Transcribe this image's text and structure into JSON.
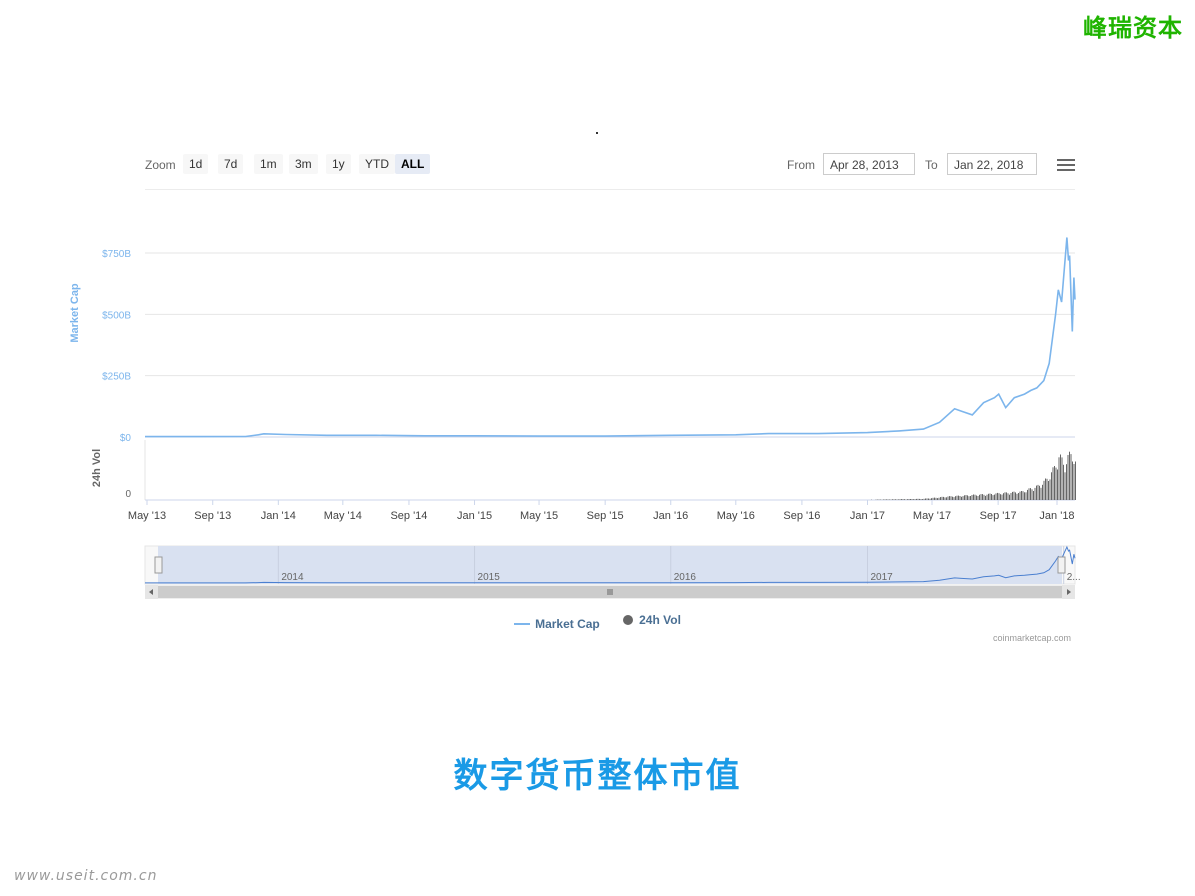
{
  "brand": "峰瑞资本",
  "slide_title": "数字货币整体市值",
  "watermark": "www.useit.com.cn",
  "toolbar": {
    "zoom_label": "Zoom",
    "zoom_buttons": [
      "1d",
      "7d",
      "1m",
      "3m",
      "1y",
      "YTD",
      "ALL"
    ],
    "active_zoom": "ALL",
    "from_label": "From",
    "from_value": "Apr 28, 2013",
    "to_label": "To",
    "to_value": "Jan 22, 2018",
    "menu_icon": "hamburger-menu-icon"
  },
  "legend": {
    "market_cap": "Market Cap",
    "vol": "24h Vol"
  },
  "credits": "coinmarketcap.com",
  "colors": {
    "market_cap": "#7cb5ec",
    "volume": "#666666",
    "navigator_fill": "#d9e1f1",
    "brand": "#1fb400",
    "title": "#1a9ae6"
  },
  "chart_data": {
    "type": "line",
    "xlabel": "",
    "ylabel": "Market Cap",
    "ylabel2": "24h Vol",
    "yticks": [
      "$750B",
      "$500B",
      "$250B",
      "$0"
    ],
    "yticks2": [
      "0"
    ],
    "ylim": [
      0,
      750
    ],
    "y_unit": "B USD",
    "xticks": [
      "May '13",
      "Sep '13",
      "Jan '14",
      "May '14",
      "Sep '14",
      "Jan '15",
      "May '15",
      "Sep '15",
      "Jan '16",
      "May '16",
      "Sep '16",
      "Jan '17",
      "May '17",
      "Sep '17",
      "Jan '18"
    ],
    "navigator_ticks": [
      "2014",
      "2015",
      "2016",
      "2017",
      "2..."
    ],
    "grid": true,
    "legend_position": "bottom",
    "series": [
      {
        "name": "Market Cap",
        "x": [
          "2013-04-28",
          "2013-08-01",
          "2013-11-01",
          "2013-11-25",
          "2013-12-05",
          "2014-01-15",
          "2014-04-01",
          "2014-07-01",
          "2014-10-01",
          "2015-01-01",
          "2015-05-01",
          "2015-09-01",
          "2016-01-01",
          "2016-05-01",
          "2016-07-01",
          "2016-10-01",
          "2017-01-01",
          "2017-03-01",
          "2017-04-15",
          "2017-05-15",
          "2017-06-12",
          "2017-06-25",
          "2017-07-15",
          "2017-08-05",
          "2017-08-25",
          "2017-09-02",
          "2017-09-15",
          "2017-10-01",
          "2017-10-20",
          "2017-11-01",
          "2017-11-12",
          "2017-11-25",
          "2017-12-05",
          "2017-12-17",
          "2017-12-22",
          "2017-12-28",
          "2018-01-07",
          "2018-01-10",
          "2018-01-12",
          "2018-01-17",
          "2018-01-18",
          "2018-01-20",
          "2018-01-22"
        ],
        "values": [
          1.5,
          1.5,
          2,
          9,
          13,
          10,
          7,
          7,
          5,
          5,
          3.5,
          3.5,
          7,
          9,
          14,
          14,
          18,
          25,
          32,
          60,
          115,
          105,
          90,
          140,
          160,
          175,
          120,
          160,
          175,
          190,
          200,
          230,
          300,
          500,
          600,
          550,
          813,
          720,
          740,
          430,
          500,
          650,
          560
        ]
      },
      {
        "name": "24h Vol",
        "x": [
          "2013-04-28",
          "2013-12-01",
          "2014-06-01",
          "2015-06-01",
          "2016-06-01",
          "2017-01-01",
          "2017-04-15",
          "2017-06-01",
          "2017-08-15",
          "2017-10-15",
          "2017-11-15",
          "2017-12-01",
          "2017-12-15",
          "2017-12-22",
          "2018-01-01",
          "2018-01-08",
          "2018-01-17",
          "2018-01-22"
        ],
        "values": [
          0.05,
          0.05,
          0.05,
          0.05,
          0.05,
          0.1,
          0.5,
          1.5,
          2.5,
          3.5,
          6,
          9,
          14,
          19,
          15,
          18,
          20,
          16
        ]
      }
    ]
  }
}
